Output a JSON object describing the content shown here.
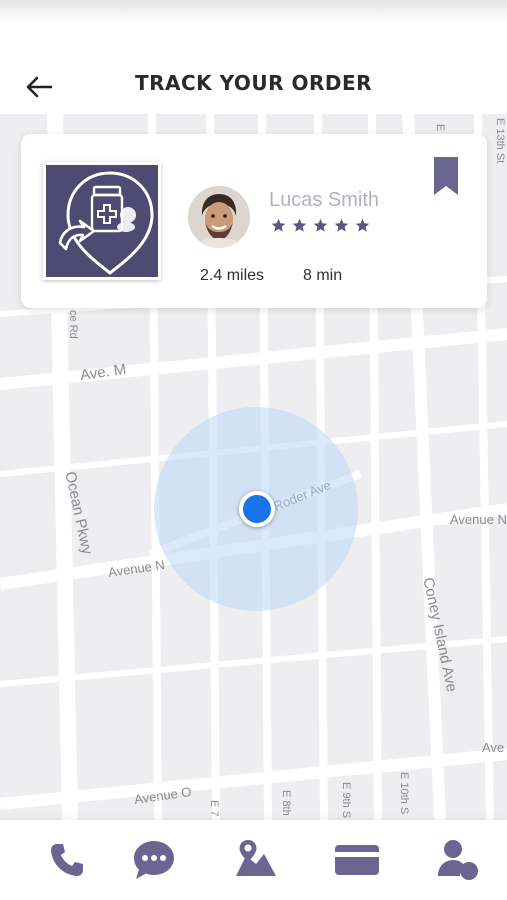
{
  "header": {
    "title": "TRACK YOUR ORDER",
    "back_icon": "arrow-left-icon"
  },
  "driver_card": {
    "pharmacy_logo_icon": "pharmacy-location-pin-icon",
    "driver_name": "Lucas Smith",
    "rating": 5,
    "rating_max": 5,
    "distance": "2.4 miles",
    "eta": "8 min",
    "bookmark_icon": "bookmark-icon"
  },
  "map": {
    "streets": [
      {
        "name": "Ave. M"
      },
      {
        "name": "Ocean Pkwy"
      },
      {
        "name": "Avenue N"
      },
      {
        "name": "Roder Ave"
      },
      {
        "name": "Avenue N"
      },
      {
        "name": "Coney Island Ave"
      },
      {
        "name": "Avenue O"
      },
      {
        "name": "E 7"
      },
      {
        "name": "E 8th"
      },
      {
        "name": "E 9th S"
      },
      {
        "name": "E 10th S"
      },
      {
        "name": "E 13th St"
      },
      {
        "name": "E"
      },
      {
        "name": "Ave"
      },
      {
        "name": "ce Rd"
      }
    ]
  },
  "bottom_nav": [
    {
      "icon": "phone-icon"
    },
    {
      "icon": "chat-icon"
    },
    {
      "icon": "map-pin-icon"
    },
    {
      "icon": "credit-card-icon"
    },
    {
      "icon": "user-icon"
    }
  ],
  "colors": {
    "brand": "#4e4a72",
    "icon": "#6b6591",
    "location": "#1a73e8",
    "map_bg": "#eeeef0"
  }
}
